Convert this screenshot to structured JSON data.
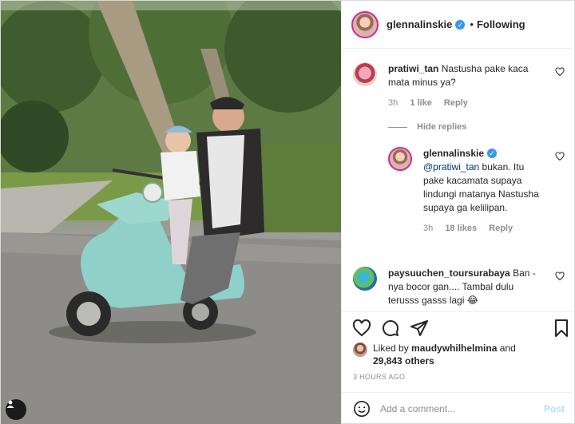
{
  "post": {
    "owner": "glennalinskie",
    "follow_status": "Following",
    "separator": "•"
  },
  "comments": [
    {
      "user": "pratiwi_tan",
      "text": "Nastusha pake kaca mata minus ya?",
      "time": "3h",
      "likes": "1 like",
      "reply": "Reply"
    },
    {
      "user": "paysuuchen_toursurabaya",
      "text": "Ban - nya bocor gan.... Tambal dulu terusss gasss lagi 😂"
    }
  ],
  "hide_replies": "Hide replies",
  "reply": {
    "user": "glennalinskie",
    "mention": "@pratiwi_tan",
    "text": " bukan. Itu pake kacamata supaya lindungi matanya Nastusha supaya ga kelilipan.",
    "time": "3h",
    "likes": "18 likes",
    "reply": "Reply"
  },
  "liked_by": {
    "prefix": "Liked by ",
    "user": "maudywhilhelmina",
    "middle": " and",
    "count": "29,843 others"
  },
  "time_ago": "3 HOURS AGO",
  "add_comment": {
    "placeholder": "Add a comment...",
    "post_label": "Post"
  },
  "colors": {
    "verified": "#3897f0",
    "post_disabled": "#b2dffc",
    "ring": "#d6249f",
    "scooter": "#8fd0c8"
  },
  "icons": [
    "heart-icon",
    "comment-icon",
    "share-icon",
    "bookmark-icon",
    "emoji-icon",
    "tagged-user-icon",
    "verified-icon"
  ]
}
